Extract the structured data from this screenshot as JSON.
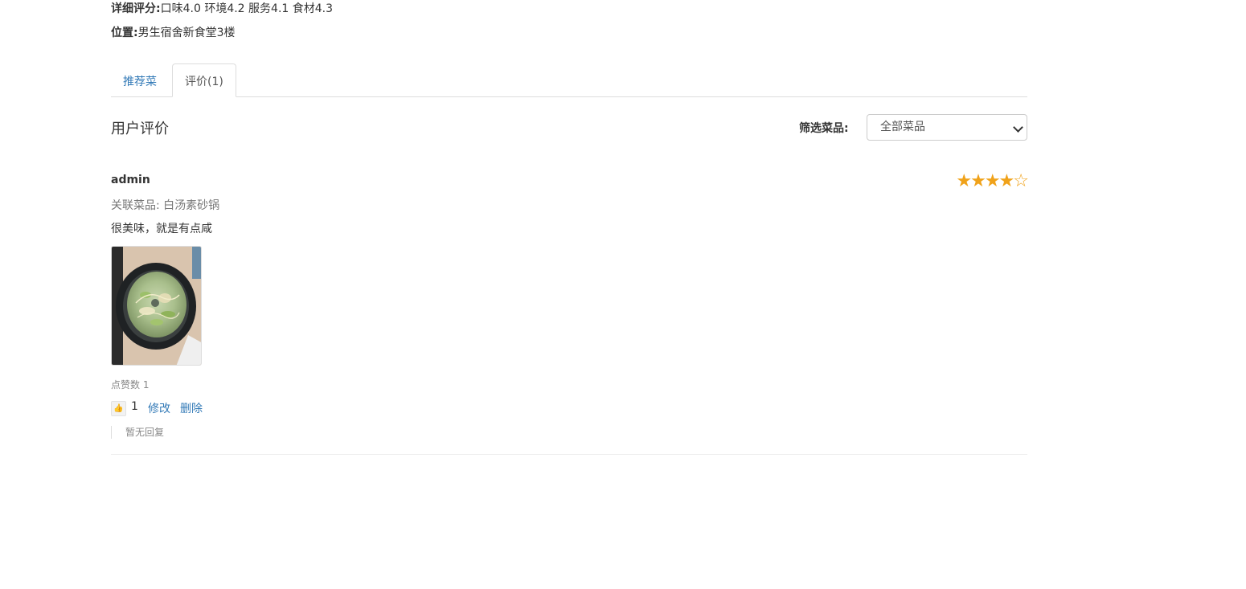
{
  "info": {
    "detail_label": "详细评分:",
    "detail_value": "口味4.0 环境4.2 服务4.1 食材4.3",
    "location_label": "位置:",
    "location_value": "男生宿舍新食堂3楼"
  },
  "tabs": [
    {
      "label": "推荐菜",
      "active": false
    },
    {
      "label": "评价(1)",
      "active": true
    }
  ],
  "reviews_section": {
    "title": "用户评价",
    "filter_label": "筛选菜品:",
    "filter_selected": "全部菜品"
  },
  "reviews": [
    {
      "user": "admin",
      "rating": 4,
      "rating_max": 5,
      "stars_text": "★★★★☆",
      "dish_line": "关联菜品: 白汤素砂锅",
      "comment": "很美味，就是有点咸",
      "likes_line": "点赞数 1",
      "like_icon": "thumbs-up-icon",
      "like_glyph": "👍",
      "like_count": "1",
      "edit_label": "修改",
      "delete_label": "删除",
      "reply_text": "暂无回复"
    }
  ],
  "colors": {
    "link": "#337ab7",
    "star": "#f0a21a",
    "border": "#dddddd"
  }
}
